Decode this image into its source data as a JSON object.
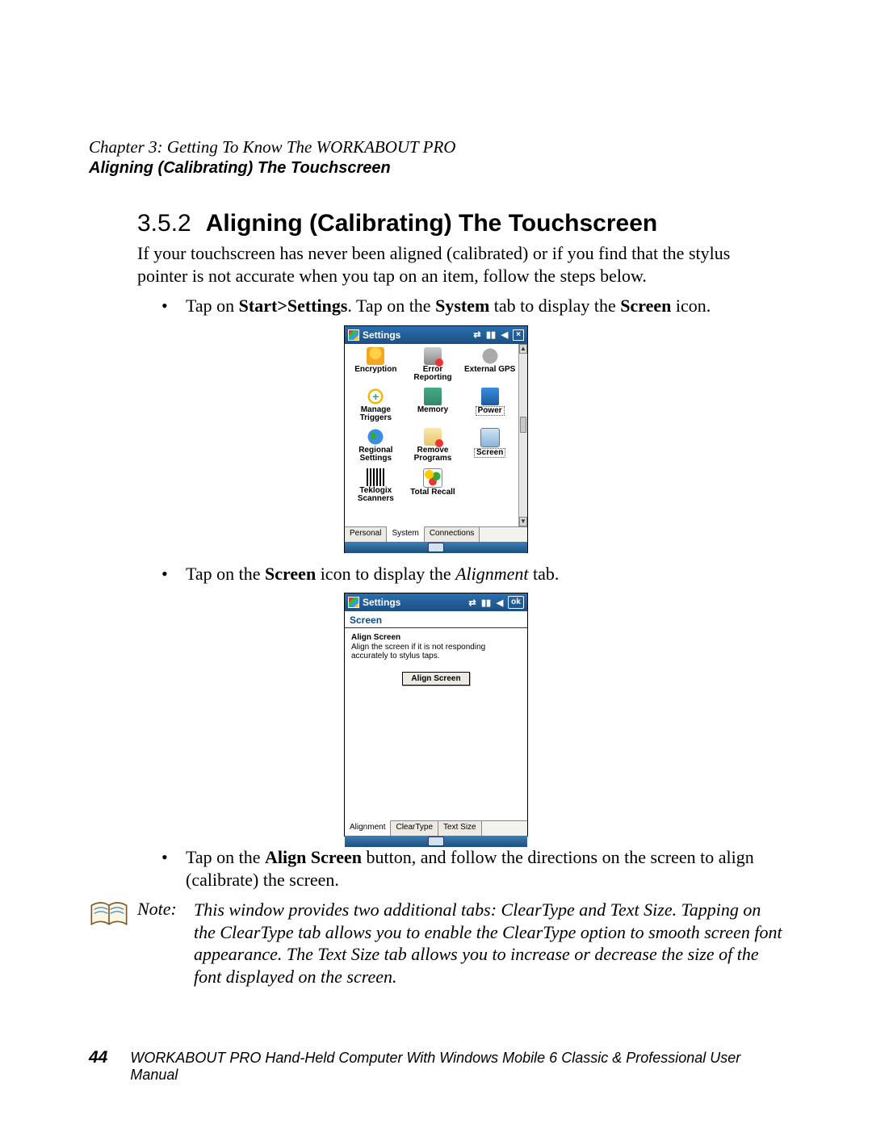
{
  "header": {
    "chapter_line": "Chapter 3:  Getting To Know The WORKABOUT PRO",
    "subtitle": "Aligning (Calibrating) The Touchscreen"
  },
  "section": {
    "number": "3.5.2",
    "title": "Aligning (Calibrating) The Touchscreen"
  },
  "intro": "If your touchscreen has never been aligned (calibrated) or if you find that the stylus pointer is not accurate when you tap on an item, follow the steps below.",
  "bullets": {
    "b1_pre": "Tap on ",
    "b1_bold1": "Start>Settings",
    "b1_mid1": ". Tap on the ",
    "b1_bold2": "System",
    "b1_mid2": " tab to display the ",
    "b1_bold3": "Screen",
    "b1_end": " icon.",
    "b2_pre": "Tap on the ",
    "b2_bold1": "Screen",
    "b2_mid1": " icon to display the ",
    "b2_ital": "Alignment",
    "b2_end": " tab.",
    "b3_pre": "Tap on the ",
    "b3_bold1": "Align Screen",
    "b3_end": " button, and follow the directions on the screen to align (calibrate) the screen."
  },
  "screenshot1": {
    "title": "Settings",
    "icons": [
      {
        "label": "Encryption"
      },
      {
        "label": "Error Reporting"
      },
      {
        "label": "External GPS"
      },
      {
        "label": "Manage Triggers"
      },
      {
        "label": "Memory"
      },
      {
        "label": "Power"
      },
      {
        "label": "Regional Settings"
      },
      {
        "label": "Remove Programs"
      },
      {
        "label": "Screen"
      },
      {
        "label": "Teklogix Scanners"
      },
      {
        "label": "Total Recall"
      }
    ],
    "tabs": [
      "Personal",
      "System",
      "Connections"
    ],
    "active_tab": "System"
  },
  "screenshot2": {
    "title": "Settings",
    "ok": "ok",
    "heading": "Screen",
    "sub_heading": "Align Screen",
    "desc": "Align the screen if it is not responding accurately to stylus taps.",
    "button": "Align Screen",
    "tabs": [
      "Alignment",
      "ClearType",
      "Text Size"
    ],
    "active_tab": "Alignment"
  },
  "note": {
    "label": "Note:",
    "text": "This window provides two additional tabs: ClearType and Text Size. Tapping on the ClearType tab allows you to enable the ClearType option to smooth screen font appearance. The Text Size tab allows you to increase or decrease the size of the font displayed on the screen."
  },
  "footer": {
    "page": "44",
    "text": "WORKABOUT PRO Hand-Held Computer With Windows Mobile 6 Classic & Professional User Manual"
  }
}
